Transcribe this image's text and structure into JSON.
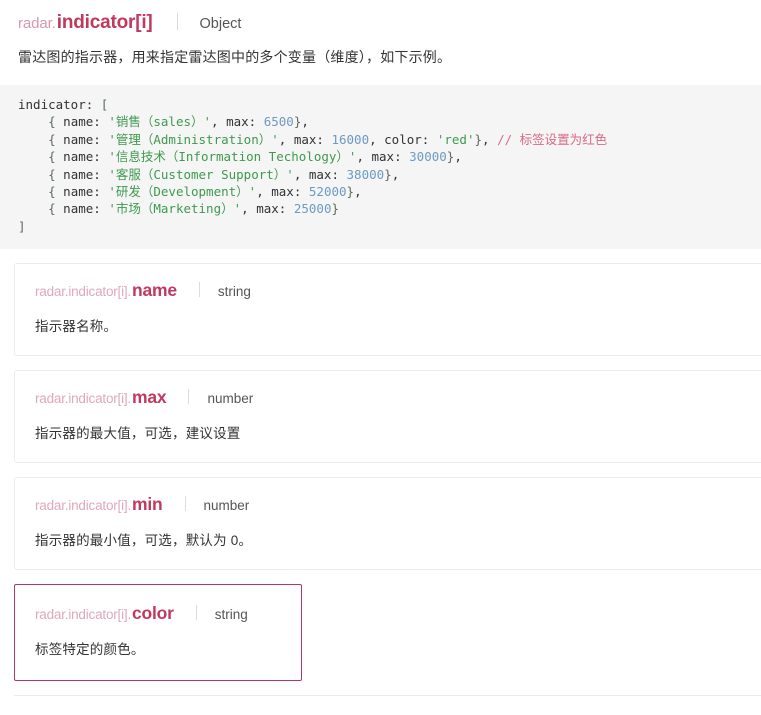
{
  "header": {
    "path_prefix": "radar.",
    "path_name": "indicator[i]",
    "type": "Object"
  },
  "intro": {
    "description": "雷达图的指示器，用来指定雷达图中的多个变量（维度），如下示例。"
  },
  "code": {
    "lines": [
      [
        {
          "t": "indicator",
          "c": "key"
        },
        {
          "t": ": ",
          "c": "plain"
        },
        {
          "t": "[",
          "c": "punc"
        }
      ],
      [
        {
          "t": "    ",
          "c": "plain"
        },
        {
          "t": "{",
          "c": "punc"
        },
        {
          "t": " name",
          "c": "key"
        },
        {
          "t": ": ",
          "c": "plain"
        },
        {
          "t": "'销售（sales）'",
          "c": "str"
        },
        {
          "t": ", max",
          "c": "key"
        },
        {
          "t": ": ",
          "c": "plain"
        },
        {
          "t": "6500",
          "c": "num"
        },
        {
          "t": "}",
          "c": "punc"
        },
        {
          "t": ",",
          "c": "plain"
        }
      ],
      [
        {
          "t": "    ",
          "c": "plain"
        },
        {
          "t": "{",
          "c": "punc"
        },
        {
          "t": " name",
          "c": "key"
        },
        {
          "t": ": ",
          "c": "plain"
        },
        {
          "t": "'管理（Administration）'",
          "c": "str"
        },
        {
          "t": ", max",
          "c": "key"
        },
        {
          "t": ": ",
          "c": "plain"
        },
        {
          "t": "16000",
          "c": "num"
        },
        {
          "t": ", color",
          "c": "key"
        },
        {
          "t": ": ",
          "c": "plain"
        },
        {
          "t": "'red'",
          "c": "str"
        },
        {
          "t": "}",
          "c": "punc"
        },
        {
          "t": ", ",
          "c": "plain"
        },
        {
          "t": "// 标签设置为红色",
          "c": "cmt"
        }
      ],
      [
        {
          "t": "    ",
          "c": "plain"
        },
        {
          "t": "{",
          "c": "punc"
        },
        {
          "t": " name",
          "c": "key"
        },
        {
          "t": ": ",
          "c": "plain"
        },
        {
          "t": "'信息技术（Information Techology）'",
          "c": "str"
        },
        {
          "t": ", max",
          "c": "key"
        },
        {
          "t": ": ",
          "c": "plain"
        },
        {
          "t": "30000",
          "c": "num"
        },
        {
          "t": "}",
          "c": "punc"
        },
        {
          "t": ",",
          "c": "plain"
        }
      ],
      [
        {
          "t": "    ",
          "c": "plain"
        },
        {
          "t": "{",
          "c": "punc"
        },
        {
          "t": " name",
          "c": "key"
        },
        {
          "t": ": ",
          "c": "plain"
        },
        {
          "t": "'客服（Customer Support）'",
          "c": "str"
        },
        {
          "t": ", max",
          "c": "key"
        },
        {
          "t": ": ",
          "c": "plain"
        },
        {
          "t": "38000",
          "c": "num"
        },
        {
          "t": "}",
          "c": "punc"
        },
        {
          "t": ",",
          "c": "plain"
        }
      ],
      [
        {
          "t": "    ",
          "c": "plain"
        },
        {
          "t": "{",
          "c": "punc"
        },
        {
          "t": " name",
          "c": "key"
        },
        {
          "t": ": ",
          "c": "plain"
        },
        {
          "t": "'研发（Development）'",
          "c": "str"
        },
        {
          "t": ", max",
          "c": "key"
        },
        {
          "t": ": ",
          "c": "plain"
        },
        {
          "t": "52000",
          "c": "num"
        },
        {
          "t": "}",
          "c": "punc"
        },
        {
          "t": ",",
          "c": "plain"
        }
      ],
      [
        {
          "t": "    ",
          "c": "plain"
        },
        {
          "t": "{",
          "c": "punc"
        },
        {
          "t": " name",
          "c": "key"
        },
        {
          "t": ": ",
          "c": "plain"
        },
        {
          "t": "'市场（Marketing）'",
          "c": "str"
        },
        {
          "t": ", max",
          "c": "key"
        },
        {
          "t": ": ",
          "c": "plain"
        },
        {
          "t": "25000",
          "c": "num"
        },
        {
          "t": "}",
          "c": "punc"
        }
      ],
      [
        {
          "t": "]",
          "c": "punc"
        }
      ]
    ]
  },
  "properties": [
    {
      "prefix": "radar.indicator[i].",
      "name": "name",
      "type": "string",
      "description": "指示器名称。",
      "highlighted": false
    },
    {
      "prefix": "radar.indicator[i].",
      "name": "max",
      "type": "number",
      "description": "指示器的最大值，可选，建议设置",
      "highlighted": false
    },
    {
      "prefix": "radar.indicator[i].",
      "name": "min",
      "type": "number",
      "description": "指示器的最小值，可选，默认为 0。",
      "highlighted": false
    },
    {
      "prefix": "radar.indicator[i].",
      "name": "color",
      "type": "string",
      "description": "标签特定的颜色。",
      "highlighted": true
    }
  ],
  "colors": {
    "accent": "#c0395e",
    "accent_light": "#dfa8ba",
    "highlight_border": "#b9375e",
    "code_bg": "#f5f5f5",
    "string_token": "#3f9a4e",
    "number_token": "#6b9bc3",
    "comment_token": "#d96a88"
  }
}
